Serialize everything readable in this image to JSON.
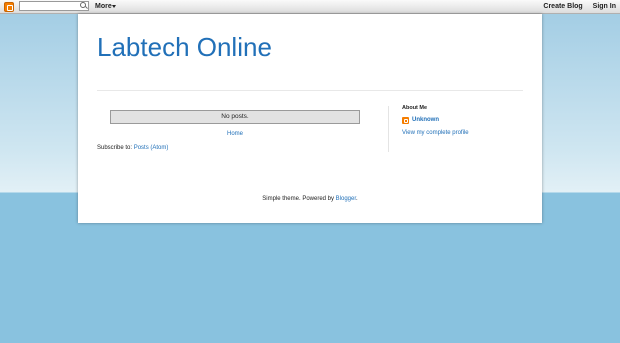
{
  "navbar": {
    "more_label": "More",
    "create_blog_label": "Create Blog",
    "sign_in_label": "Sign In"
  },
  "header": {
    "title": "Labtech Online"
  },
  "main": {
    "no_posts": "No posts.",
    "home_link": "Home",
    "subscribe_prefix": "Subscribe to:",
    "subscribe_link": "Posts (Atom)"
  },
  "sidebar": {
    "about_title": "About Me",
    "profile_name": "Unknown",
    "profile_link": "View my complete profile"
  },
  "footer": {
    "text": "Simple theme. Powered by",
    "link": "Blogger",
    "period": "."
  },
  "colors": {
    "link": "#2170b8",
    "blogger_orange": "#f57d00",
    "background_blue": "#89c2df"
  }
}
